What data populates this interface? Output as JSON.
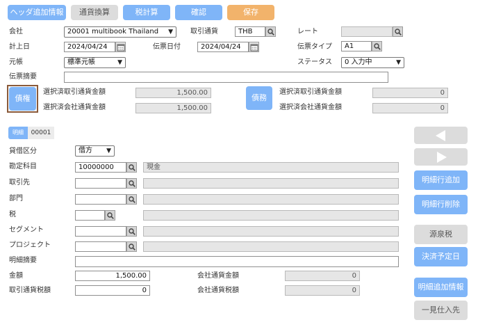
{
  "toolbar": {
    "header_info": "ヘッダ追加情報",
    "currency_convert": "通貨換算",
    "tax_calc": "税計算",
    "confirm": "確認",
    "save": "保存"
  },
  "header": {
    "company_label": "会社",
    "company_value": "20001 multibook Thailand",
    "tx_currency_label": "取引通貨",
    "tx_currency_value": "THB",
    "rate_label": "レート",
    "rate_value": "",
    "posting_date_label": "計上日",
    "posting_date_value": "2024/04/24",
    "slip_date_label": "伝票日付",
    "slip_date_value": "2024/04/24",
    "slip_type_label": "伝票タイプ",
    "slip_type_value": "A1",
    "ledger_label": "元帳",
    "ledger_value": "標準元帳",
    "status_label": "ステータス",
    "status_value": "0 入力中",
    "memo_label": "伝票摘要",
    "memo_value": ""
  },
  "summary": {
    "credit_button": "債権",
    "debt_button": "債務",
    "left_tx_amount_label": "選択済取引通貨金額",
    "left_tx_amount_value": "1,500.00",
    "left_co_amount_label": "選択済会社通貨金額",
    "left_co_amount_value": "1,500.00",
    "right_tx_amount_label": "選択済取引通貨金額",
    "right_tx_amount_value": "0",
    "right_co_amount_label": "選択済会社通貨金額",
    "right_co_amount_value": "0"
  },
  "detail": {
    "tab_label": "明細",
    "line_no": "00001",
    "dc_label": "貸借区分",
    "dc_value": "借方",
    "account_label": "勘定科目",
    "account_code": "10000000",
    "account_name": "現金",
    "partner_label": "取引先",
    "dept_label": "部門",
    "tax_label": "税",
    "segment_label": "セグメント",
    "project_label": "プロジェクト",
    "line_memo_label": "明細摘要",
    "amount_label": "金額",
    "amount_value": "1,500.00",
    "co_amount_label": "会社通貨金額",
    "co_amount_value": "0",
    "tx_tax_label": "取引通貨税額",
    "tx_tax_value": "0",
    "co_tax_label": "会社通貨税額",
    "co_tax_value": "0"
  },
  "side": {
    "add_line": "明細行追加",
    "delete_line": "明細行削除",
    "withholding": "源泉税",
    "payment_date": "決済予定日",
    "line_info": "明細追加情報",
    "one_time_vendor": "一見仕入先"
  }
}
